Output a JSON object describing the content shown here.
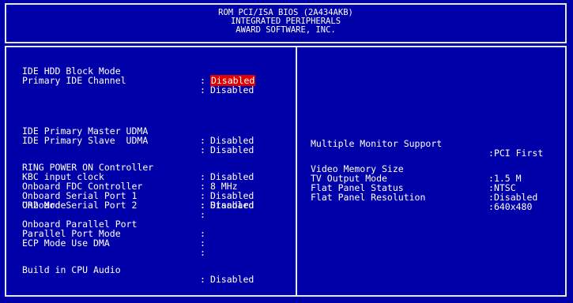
{
  "header": {
    "line1": "ROM PCI/ISA BIOS (2A434AKB)",
    "line2": "INTEGRATED PERIPHERALS",
    "line3": "AWARD SOFTWARE, INC."
  },
  "colors": {
    "background": "#0000a8",
    "text": "#ffffff",
    "highlight": "#e00000",
    "border": "#e8e8e8"
  },
  "left_items": [
    {
      "label": "IDE HDD Block Mode",
      "value": "Disabled"
    },
    {
      "label": "Primary IDE Channel",
      "value": "Disabled"
    },
    {
      "label": "IDE Primary Master UDMA",
      "value": "Disabled"
    },
    {
      "label": "IDE Primary Slave  UDMA",
      "value": "Disabled"
    },
    {
      "label": "RING POWER ON Controller",
      "value": "Disabled"
    },
    {
      "label": "KBC input clock",
      "value": "8 MHz"
    },
    {
      "label": "Onboard FDC Controller",
      "value": "Disabled"
    },
    {
      "label": "Onboard Serial Port 1",
      "value": "Disabled"
    },
    {
      "label": "Onboard Serial Port 2",
      "value": ""
    },
    {
      "label": "UR2 Mode",
      "value": "Standard"
    },
    {
      "label": "Onboard Parallel Port",
      "value": ""
    },
    {
      "label": "Parallel Port Mode",
      "value": ""
    },
    {
      "label": "ECP Mode Use DMA",
      "value": ""
    },
    {
      "label": "Build in CPU Audio",
      "value": "Disabled"
    }
  ],
  "right_items": [
    {
      "label": "Multiple Monitor Support",
      "value": "PCI First"
    },
    {
      "label": "Video Memory Size",
      "value": "1.5 M"
    },
    {
      "label": "TV Output Mode",
      "value": "NTSC"
    },
    {
      "label": "Flat Panel Status",
      "value": "Disabled"
    },
    {
      "label": "Flat Panel Resolution",
      "value": "640x480"
    }
  ],
  "separator": ":"
}
